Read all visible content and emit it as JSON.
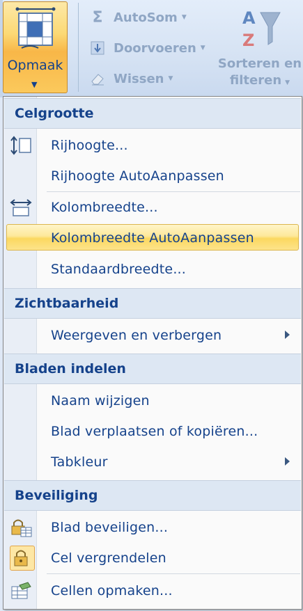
{
  "ribbon": {
    "opmaak_label": "Opmaak",
    "autosom_label": "AutoSom",
    "doorvoeren_label": "Doorvoeren",
    "wissen_label": "Wissen",
    "sorteren_line1": "Sorteren en",
    "sorteren_line2": "filteren"
  },
  "menu": {
    "sections": {
      "celgrootte": "Celgrootte",
      "zichtbaarheid": "Zichtbaarheid",
      "bladen": "Bladen indelen",
      "beveiliging": "Beveiliging"
    },
    "items": {
      "rijhoogte": "Rijhoogte...",
      "rijhoogte_auto": "Rijhoogte AutoAanpassen",
      "kolombreedte": "Kolombreedte...",
      "kolombreedte_auto": "Kolombreedte AutoAanpassen",
      "standaardbreedte": "Standaardbreedte...",
      "weergeven": "Weergeven en verbergen",
      "naam": "Naam wijzigen",
      "verplaatsen": "Blad verplaatsen of kopiëren...",
      "tabkleur": "Tabkleur",
      "blad_beveiligen": "Blad beveiligen...",
      "cel_vergrendelen": "Cel vergrendelen",
      "cellen_opmaken": "Cellen opmaken..."
    },
    "highlighted_item": "Kolombreedte AutoAanpassen"
  },
  "colors": {
    "menu_text": "#15428b",
    "highlight": "#fbd860",
    "header_bg": "#dde7f3"
  }
}
